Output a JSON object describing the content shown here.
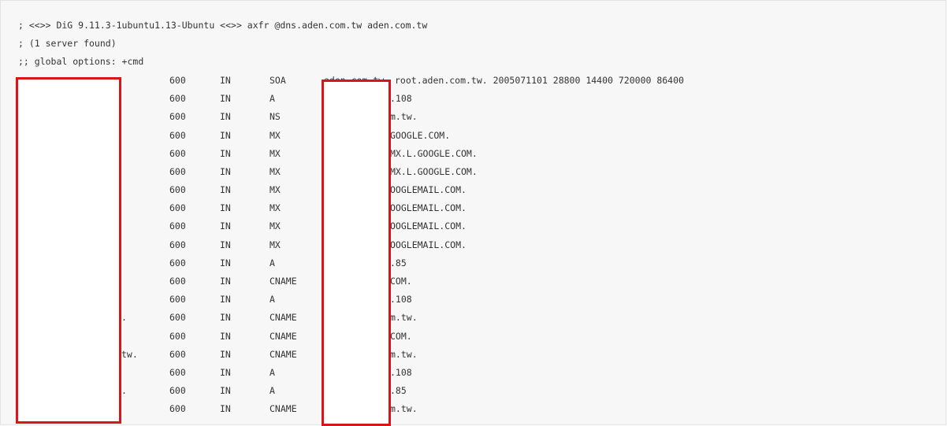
{
  "header": {
    "dig_line": "; <<>> DiG 9.11.3-1ubuntu1.13-Ubuntu <<>> axfr @dns.aden.com.tw aden.com.tw",
    "servers_line": "; (1 server found)",
    "options_line": ";; global options: +cmd"
  },
  "records": [
    {
      "host": "",
      "ttl": "600",
      "class": "IN",
      "type": "SOA",
      "data": "aden.com.tw. root.aden.com.tw. 2005071101 28800 14400 720000 86400"
    },
    {
      "host": "",
      "ttl": "600",
      "class": "IN",
      "type": "A",
      "data": ".108"
    },
    {
      "host": "",
      "ttl": "600",
      "class": "IN",
      "type": "NS",
      "data": "m.tw."
    },
    {
      "host": "",
      "ttl": "600",
      "class": "IN",
      "type": "MX",
      "data": "GOOGLE.COM."
    },
    {
      "host": "",
      "ttl": "600",
      "class": "IN",
      "type": "MX",
      "data": "MX.L.GOOGLE.COM."
    },
    {
      "host": "",
      "ttl": "600",
      "class": "IN",
      "type": "MX",
      "data": "MX.L.GOOGLE.COM."
    },
    {
      "host": "",
      "ttl": "600",
      "class": "IN",
      "type": "MX",
      "data": "OOGLEMAIL.COM."
    },
    {
      "host": "",
      "ttl": "600",
      "class": "IN",
      "type": "MX",
      "data": "OOGLEMAIL.COM."
    },
    {
      "host": "",
      "ttl": "600",
      "class": "IN",
      "type": "MX",
      "data": "OOGLEMAIL.COM."
    },
    {
      "host": "",
      "ttl": "600",
      "class": "IN",
      "type": "MX",
      "data": "OOGLEMAIL.COM."
    },
    {
      "host": "",
      "ttl": "600",
      "class": "IN",
      "type": "A",
      "data": ".85"
    },
    {
      "host": "",
      "ttl": "600",
      "class": "IN",
      "type": "CNAME",
      "data": "COM."
    },
    {
      "host": "",
      "ttl": "600",
      "class": "IN",
      "type": "A",
      "data": ".108"
    },
    {
      "host": ".",
      "ttl": "600",
      "class": "IN",
      "type": "CNAME",
      "data": "m.tw."
    },
    {
      "host": "",
      "ttl": "600",
      "class": "IN",
      "type": "CNAME",
      "data": "COM."
    },
    {
      "host": "tw.",
      "ttl": "600",
      "class": "IN",
      "type": "CNAME",
      "data": "m.tw."
    },
    {
      "host": "",
      "ttl": "600",
      "class": "IN",
      "type": "A",
      "data": ".108"
    },
    {
      "host": ".",
      "ttl": "600",
      "class": "IN",
      "type": "A",
      "data": ".85"
    },
    {
      "host": "",
      "ttl": "600",
      "class": "IN",
      "type": "CNAME",
      "data": "m.tw."
    }
  ],
  "colors": {
    "panel_background": "#f7f7f7",
    "panel_border": "#e3e3e3",
    "text": "#333333",
    "redaction_border": "#d9151b",
    "redaction_fill": "#ffffff"
  }
}
